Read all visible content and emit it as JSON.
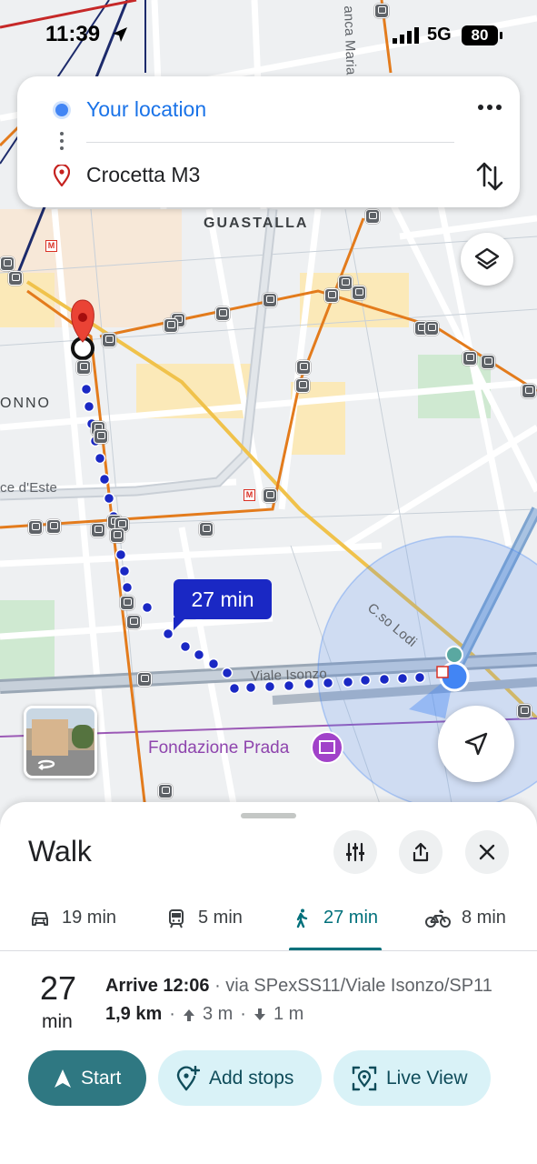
{
  "status_bar": {
    "time": "11:39",
    "network": "5G",
    "battery": "80"
  },
  "route_card": {
    "origin": "Your location",
    "destination": "Crocetta M3"
  },
  "map": {
    "district": "GUASTALLA",
    "area_partial": "ONNO",
    "street_partial_top": "anca Maria",
    "street_partial_left": "ce d'Este",
    "street_corso_lodi": "C.so Lodi",
    "street_isonzo": "Viale Isonzo",
    "poi_name": "Fondazione Prada",
    "route_time_bubble": "27 min",
    "colors": {
      "route": "#1a28c4",
      "tram_line": "#e37b1c",
      "highway": "#f5c343",
      "location": "#4285f4"
    }
  },
  "sheet": {
    "title": "Walk",
    "tabs": [
      {
        "mode": "drive",
        "label": "19 min",
        "icon": "car-icon"
      },
      {
        "mode": "transit",
        "label": "5 min",
        "icon": "tram-icon"
      },
      {
        "mode": "walk",
        "label": "27 min",
        "icon": "walk-icon",
        "selected": true
      },
      {
        "mode": "bike",
        "label": "8 min",
        "icon": "bike-icon"
      }
    ],
    "duration": "27",
    "duration_unit": "min",
    "arrive": "Arrive 12:06",
    "via": " · via SPexSS11/Viale Isonzo/SP11",
    "distance": "1,9 km",
    "ascent": "3 m",
    "descent": "1 m",
    "separator": "·",
    "buttons": {
      "start": "Start",
      "add_stops": "Add stops",
      "live_view": "Live View"
    },
    "accent_color": "#00707b"
  }
}
